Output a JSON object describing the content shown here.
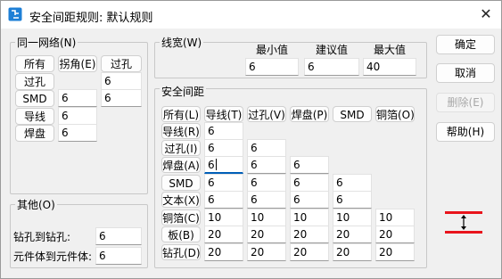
{
  "window": {
    "title": "安全间距规则: 默认规则",
    "close_glyph": "✕",
    "icon": "app-icon"
  },
  "net_group": {
    "label": "同一网络(N)",
    "headers": [
      "所有",
      "拐角(E)",
      "过孔"
    ],
    "rows": [
      {
        "label": "过孔",
        "values": [
          "",
          "6"
        ]
      },
      {
        "label": "SMD",
        "values": [
          "6",
          "6"
        ]
      },
      {
        "label": "导线",
        "values": [
          "6"
        ]
      },
      {
        "label": "焊盘",
        "values": [
          "6"
        ]
      }
    ]
  },
  "other_group": {
    "label": "其他(O)",
    "drill_label": "钻孔到钻孔:",
    "drill_value": "6",
    "comp_label": "元件体到元件体:",
    "comp_value": "6"
  },
  "width_group": {
    "label": "线宽(W)",
    "min_label": "最小值",
    "rec_label": "建议值",
    "max_label": "最大值",
    "min_value": "6",
    "rec_value": "6",
    "max_value": "40"
  },
  "clearance_group": {
    "label": "安全间距",
    "headers": [
      "所有(L)",
      "导线(T)",
      "过孔(V)",
      "焊盘(P)",
      "SMD",
      "铜箔(O)"
    ],
    "rows": [
      {
        "label": "导线(R)",
        "values": [
          "6"
        ]
      },
      {
        "label": "过孔(I)",
        "values": [
          "6",
          "6"
        ]
      },
      {
        "label": "焊盘(A)",
        "values": [
          "6",
          "6",
          "6"
        ]
      },
      {
        "label": "SMD",
        "values": [
          "6",
          "6",
          "6",
          "6"
        ]
      },
      {
        "label": "文本(X)",
        "values": [
          "6",
          "6",
          "6",
          "6"
        ]
      },
      {
        "label": "铜箔(C)",
        "values": [
          "10",
          "10",
          "10",
          "10",
          "10"
        ]
      },
      {
        "label": "板(B)",
        "values": [
          "20",
          "20",
          "20",
          "20",
          "20"
        ]
      },
      {
        "label": "钻孔(D)",
        "values": [
          "20",
          "20",
          "20",
          "20",
          "20"
        ]
      }
    ]
  },
  "buttons": {
    "ok": "确定",
    "cancel": "取消",
    "delete": "删除(E)",
    "help": "帮助(H)"
  },
  "preview": {
    "icon": "clearance-preview-icon",
    "line_color": "#e8141c",
    "arrow_color": "#000000"
  },
  "colors": {
    "focus_underline": "#005fb8",
    "app_icon": "#1e7fd6"
  }
}
